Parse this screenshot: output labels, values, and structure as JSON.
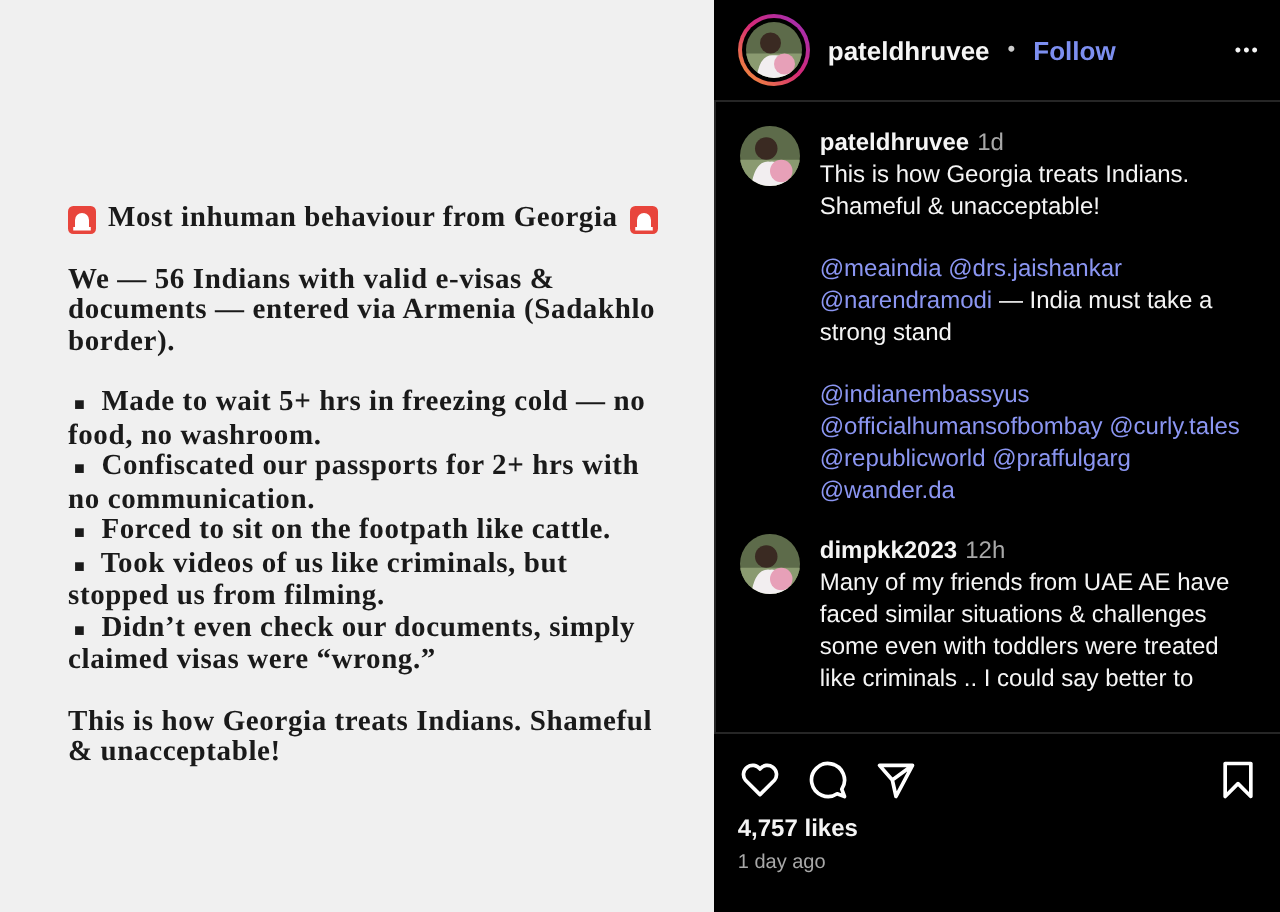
{
  "post_image": {
    "heading": "Most inhuman behaviour from Georgia",
    "intro": "We — 56 Indians with valid e-visas & documents — entered via Armenia (Sadakhlo border).",
    "bullets": [
      {
        "marker": "■",
        "text": "Made to wait 5+ hrs in freezing cold — no food, no washroom."
      },
      {
        "marker": "■",
        "text": "Confiscated our passports for 2+ hrs with no communication."
      },
      {
        "marker": "■",
        "text": "Forced to sit on the footpath like cattle."
      },
      {
        "marker": "■",
        "text": "Took videos of us like criminals, but stopped us from filming."
      },
      {
        "marker": "■",
        "text": "Didn’t even check our documents, simply claimed visas were “wrong.”"
      }
    ],
    "closing": "This is how Georgia treats Indians. Shameful & unacceptable!"
  },
  "header": {
    "username": "pateldhruvee",
    "separator": "•",
    "follow": "Follow",
    "more": "•••"
  },
  "comments": [
    {
      "username": "pateldhruvee",
      "time": "1d",
      "paragraphs": [
        [
          {
            "kind": "text",
            "text": "This is how Georgia treats Indians. Shameful & unacceptable!"
          }
        ],
        [
          {
            "kind": "mention",
            "text": "@meaindia"
          },
          {
            "kind": "mention",
            "text": "@drs.jaishankar"
          },
          {
            "kind": "mention",
            "text": "@narendramodi"
          },
          {
            "kind": "text",
            "text": " — India must take a strong stand"
          }
        ],
        [
          {
            "kind": "mention",
            "text": "@indianembassyus"
          },
          {
            "kind": "mention",
            "text": "@officialhumansofbombay"
          },
          {
            "kind": "mention",
            "text": "@curly.tales"
          },
          {
            "kind": "mention",
            "text": "@republicworld"
          },
          {
            "kind": "mention",
            "text": "@praffulgarg"
          },
          {
            "kind": "mention",
            "text": "@wander.da"
          }
        ]
      ]
    },
    {
      "username": "dimpkk2023",
      "time": "12h",
      "paragraphs": [
        [
          {
            "kind": "text",
            "text": "Many of my friends from UAE AE have faced similar situations & challenges some even with toddlers were treated like criminals .. I could say better to"
          }
        ]
      ]
    }
  ],
  "likes": "4,757 likes",
  "posted": "1 day ago"
}
